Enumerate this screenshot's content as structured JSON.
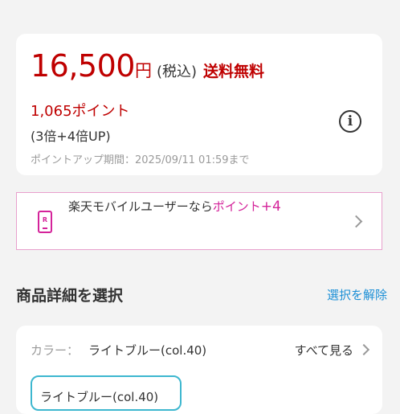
{
  "price": {
    "amount": "16,500",
    "unit": "円",
    "tax_label": "(税込)",
    "shipping": "送料無料"
  },
  "points": {
    "amount": "1,065ポイント",
    "rate": "(3倍+4倍UP)",
    "period": "ポイントアップ期間：2025/09/11 01:59まで"
  },
  "mobile_banner": {
    "text": "楽天モバイルユーザーなら",
    "highlight": "ポイント",
    "plus": "+4"
  },
  "section": {
    "title": "商品詳細を選択",
    "clear_label": "選択を解除"
  },
  "selector": {
    "color_label": "カラー：",
    "color_value": "ライトブルー(col.40)",
    "see_all": "すべて見る",
    "chip_label": "ライトブルー(col.40)"
  },
  "colors": {
    "price_red": "#bf0000",
    "rakuten_pink": "#d4239a",
    "link_blue": "#1b8fd6",
    "chip_border": "#3db7cf"
  },
  "icons": [
    "info-icon",
    "phone-icon",
    "chevron-right-icon"
  ]
}
